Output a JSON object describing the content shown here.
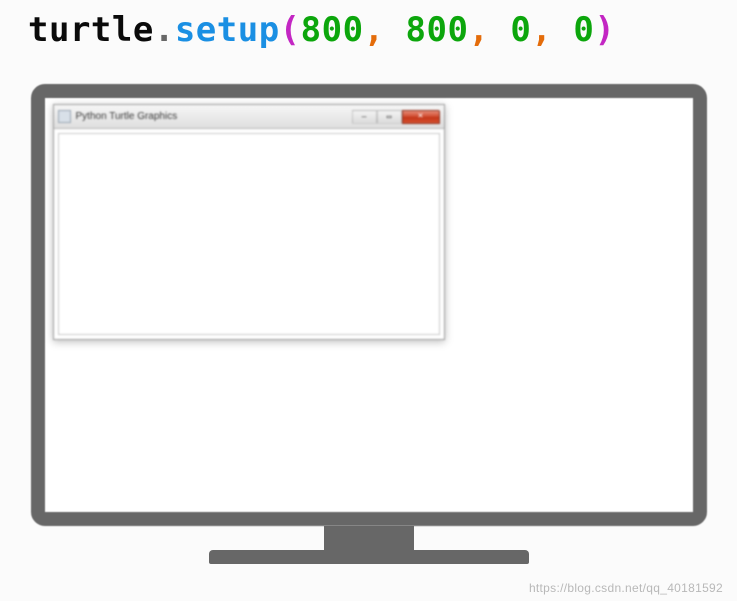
{
  "code": {
    "module": "turtle",
    "dot": ".",
    "method": "setup",
    "paren_open": "(",
    "arg1": "800",
    "comma1": ", ",
    "arg2": "800",
    "comma2": ", ",
    "arg3": "0",
    "comma3": ", ",
    "arg4": "0",
    "paren_close": ")"
  },
  "window": {
    "title": "Python Turtle Graphics",
    "min_glyph": "—",
    "max_glyph": "▭",
    "close_glyph": "✕"
  },
  "watermark": "https://blog.csdn.net/qq_40181592"
}
